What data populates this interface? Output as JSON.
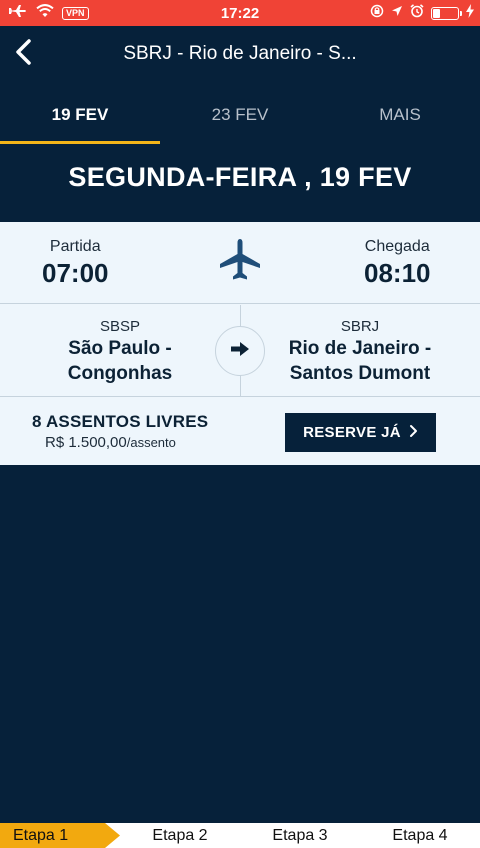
{
  "status_bar": {
    "time": "17:22",
    "vpn": "VPN",
    "battery_level": 0.3,
    "icons": [
      "airplane-mode-icon",
      "wifi-icon",
      "vpn-icon",
      "screen-lock-icon",
      "location-icon",
      "alarm-icon",
      "battery-icon",
      "charging-icon"
    ]
  },
  "header": {
    "title": "SBRJ - Rio de Janeiro - S...",
    "back_icon": "chevron-left-icon"
  },
  "tabs": [
    {
      "label": "19 FEV",
      "active": true
    },
    {
      "label": "23 FEV",
      "active": false
    },
    {
      "label": "MAIS",
      "active": false
    }
  ],
  "day_heading": "SEGUNDA-FEIRA ,  19 FEV",
  "flight": {
    "departure_label": "Partida",
    "departure_time": "07:00",
    "arrival_label": "Chegada",
    "arrival_time": "08:10",
    "origin": {
      "code": "SBSP",
      "name_line1": "São Paulo -",
      "name_line2": "Congonhas"
    },
    "destination": {
      "code": "SBRJ",
      "name_line1": "Rio de Janeiro -",
      "name_line2": "Santos Dumont"
    },
    "seats": "8 ASSENTOS LIVRES",
    "price": "R$ 1.500,00",
    "price_unit": "/assento",
    "reserve_label": "RESERVE JÁ"
  },
  "steps": [
    {
      "label": "Etapa 1",
      "active": true
    },
    {
      "label": "Etapa 2",
      "active": false
    },
    {
      "label": "Etapa 3",
      "active": false
    },
    {
      "label": "Etapa 4",
      "active": false
    }
  ],
  "colors": {
    "background": "#06213a",
    "status_bar": "#f04336",
    "accent": "#f3b519",
    "card": "#eef6fc",
    "step_active": "#f2a90f"
  }
}
